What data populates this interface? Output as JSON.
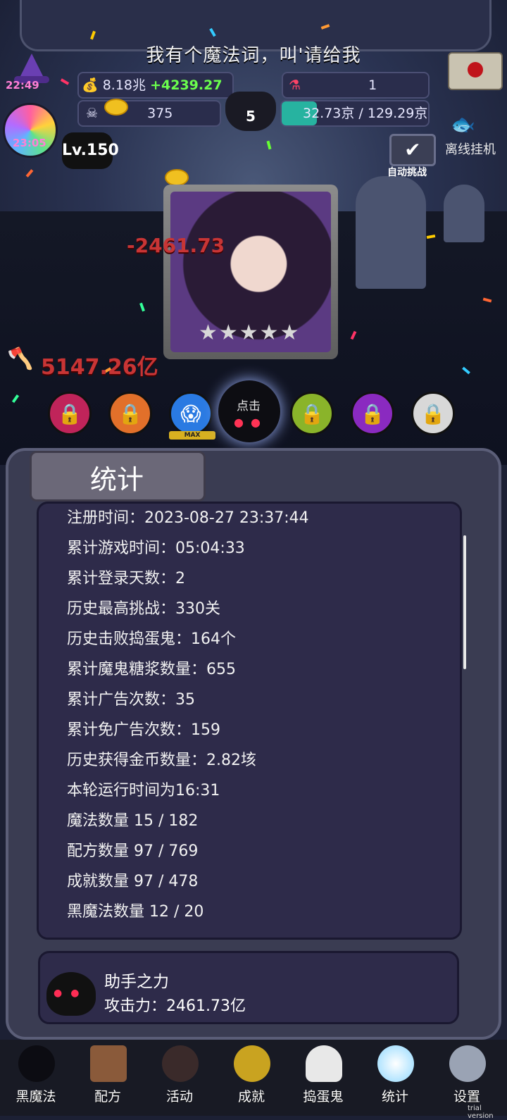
{
  "header": {
    "spell_text": "我有个魔法词，叫'请给我",
    "timer_top": "22:49",
    "timer_candy": "23:05",
    "gold_amount": "8.18兆",
    "gold_rate": "+4239.27亿",
    "skull_count": "375",
    "cauldron_count": "5",
    "potion_count": "1",
    "progress_text": "32.73京 / 129.29京",
    "level": "Lv.150",
    "offline_label": "离线挂机",
    "auto_challenge_label": "自动挑战"
  },
  "battle": {
    "damage_near": "-2461.73",
    "damage_left": "5147.26亿",
    "click_label": "点击",
    "max_tag": "MAX",
    "star_count": 5
  },
  "stats": {
    "title": "统计",
    "items": [
      "注册时间：2023-08-27 23:37:44",
      "累计游戏时间：05:04:33",
      "累计登录天数：2",
      "历史最高挑战：330关",
      "历史击败捣蛋鬼：164个",
      "累计魔鬼糖浆数量：655",
      "累计广告次数：35",
      "累计免广告次数：159",
      "历史获得金币数量：2.82垓",
      "本轮运行时间为16:31",
      "魔法数量 15 / 182",
      "配方数量 97 / 769",
      "成就数量 97 / 478",
      "黑魔法数量 12 / 20"
    ]
  },
  "helper": {
    "title": "助手之力",
    "attack": "攻击力：2461.73亿"
  },
  "nav": [
    {
      "label": "黑魔法",
      "icon": "black-magic-icon"
    },
    {
      "label": "配方",
      "icon": "recipe-book-icon"
    },
    {
      "label": "活动",
      "icon": "event-cake-icon"
    },
    {
      "label": "成就",
      "icon": "achievement-trophy-icon"
    },
    {
      "label": "捣蛋鬼",
      "icon": "ghost-icon"
    },
    {
      "label": "统计",
      "icon": "stats-globe-icon"
    },
    {
      "label": "设置",
      "icon": "gear-icon"
    }
  ],
  "watermark": "trial version",
  "colors": {
    "accent_green": "#6bff4d",
    "damage_red": "#c83535",
    "panel_bg": "#2e2b4a"
  }
}
